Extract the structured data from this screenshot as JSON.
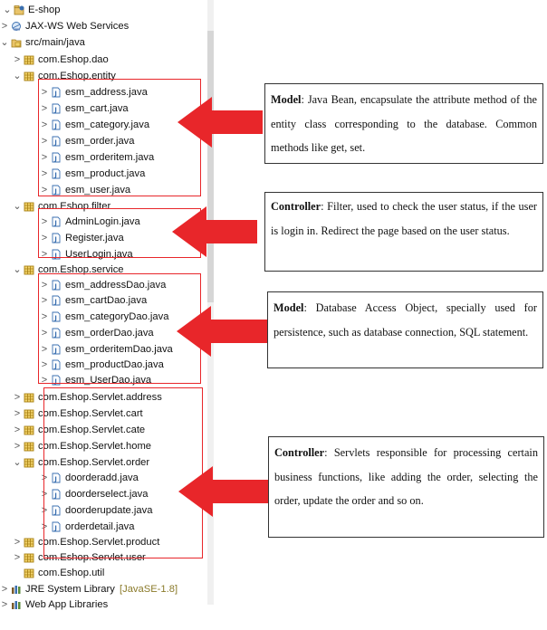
{
  "tree": {
    "root": "E-shop",
    "items": [
      {
        "label": "JAX-WS Web Services"
      },
      {
        "label": "src/main/java"
      },
      {
        "label": "com.Eshop.dao"
      },
      {
        "label": "com.Eshop.entity"
      },
      {
        "label": "esm_address.java"
      },
      {
        "label": "esm_cart.java"
      },
      {
        "label": "esm_category.java"
      },
      {
        "label": "esm_order.java"
      },
      {
        "label": "esm_orderitem.java"
      },
      {
        "label": "esm_product.java"
      },
      {
        "label": "esm_user.java"
      },
      {
        "label": "com.Eshop.filter"
      },
      {
        "label": "AdminLogin.java"
      },
      {
        "label": "Register.java"
      },
      {
        "label": "UserLogin.java"
      },
      {
        "label": "com.Eshop.service"
      },
      {
        "label": "esm_addressDao.java"
      },
      {
        "label": "esm_cartDao.java"
      },
      {
        "label": "esm_categoryDao.java"
      },
      {
        "label": "esm_orderDao.java"
      },
      {
        "label": "esm_orderitemDao.java"
      },
      {
        "label": "esm_productDao.java"
      },
      {
        "label": "esm_UserDao.java"
      },
      {
        "label": "com.Eshop.Servlet.address"
      },
      {
        "label": "com.Eshop.Servlet.cart"
      },
      {
        "label": "com.Eshop.Servlet.cate"
      },
      {
        "label": "com.Eshop.Servlet.home"
      },
      {
        "label": "com.Eshop.Servlet.order"
      },
      {
        "label": "doorderadd.java"
      },
      {
        "label": "doorderselect.java"
      },
      {
        "label": "doorderupdate.java"
      },
      {
        "label": "orderdetail.java"
      },
      {
        "label": "com.Eshop.Servlet.product"
      },
      {
        "label": "com.Eshop.Servlet.user"
      },
      {
        "label": "com.Eshop.util"
      },
      {
        "label": "JRE System Library",
        "decoration": "[JavaSE-1.8]"
      },
      {
        "label": "Web App Libraries"
      }
    ]
  },
  "notes": [
    {
      "title": "Model",
      "text": ": Java Bean, encapsulate the attribute method of the entity class corresponding to the database. Common methods like get, set."
    },
    {
      "title": "Controller",
      "text": ": Filter, used to check the user status, if the user is login in. Redirect the page based on the user status."
    },
    {
      "title": "Model",
      "text": ": Database Access Object, specially used for persistence, such as database connection, SQL statement."
    },
    {
      "title": "Controller",
      "text": ": Servlets responsible for processing certain business functions, like adding the order, selecting the order, update the order and so on."
    }
  ],
  "colors": {
    "accent": "#e8262a",
    "package": "#b08a1a",
    "java": "#3a6fb0"
  },
  "icons": {
    "project": "project-icon",
    "package": "package-icon",
    "java": "java-file-icon",
    "library": "library-icon"
  }
}
